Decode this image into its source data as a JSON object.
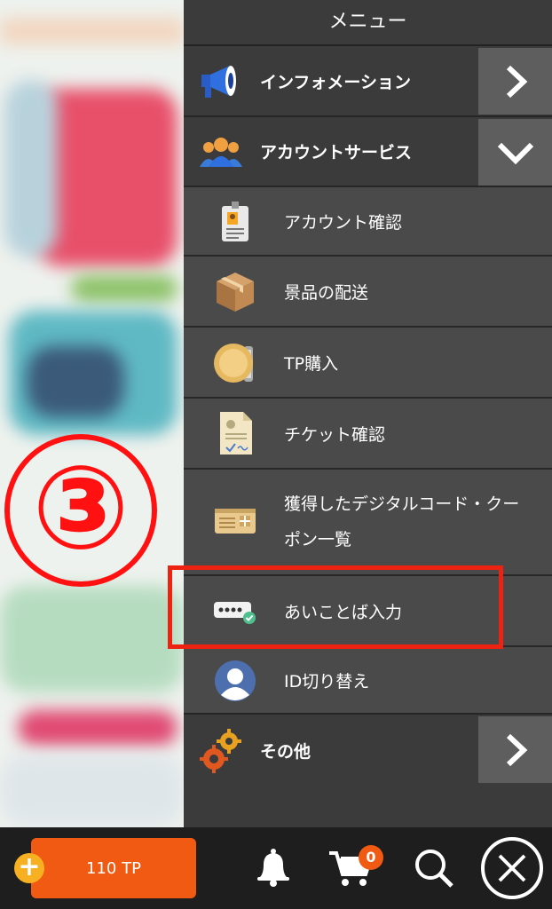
{
  "step_number": "③",
  "menu": {
    "title": "メニュー",
    "sections": [
      {
        "label": "インフォメーション",
        "icon": "megaphone-icon",
        "arrow": "chevron-right-icon"
      },
      {
        "label": "アカウントサービス",
        "icon": "people-icon",
        "arrow": "chevron-down-icon"
      }
    ],
    "items": [
      {
        "label": "アカウント確認",
        "icon": "id-badge-icon"
      },
      {
        "label": "景品の配送",
        "icon": "box-icon"
      },
      {
        "label": "TP購入",
        "icon": "coin-icon"
      },
      {
        "label": "チケット確認",
        "icon": "document-icon"
      },
      {
        "label": "獲得したデジタルコード・クーポン一覧",
        "line1": "獲得したデジタルコード・クー",
        "line2": "ポン一覧",
        "icon": "ticket-icon"
      },
      {
        "label": "あいことば入力",
        "icon": "password-icon"
      },
      {
        "label": "ID切り替え",
        "icon": "user-icon"
      }
    ],
    "other": {
      "label": "その他",
      "icon": "gears-icon",
      "arrow": "chevron-right-icon"
    }
  },
  "bottom_bar": {
    "tp_label": "110 TP",
    "cart_count": "0",
    "icons": [
      "plus-icon",
      "bell-icon",
      "cart-icon",
      "search-icon",
      "close-icon"
    ]
  },
  "colors": {
    "highlight": "#e21c1c",
    "tp_button": "#f05a12",
    "badge": "#f05a12"
  }
}
